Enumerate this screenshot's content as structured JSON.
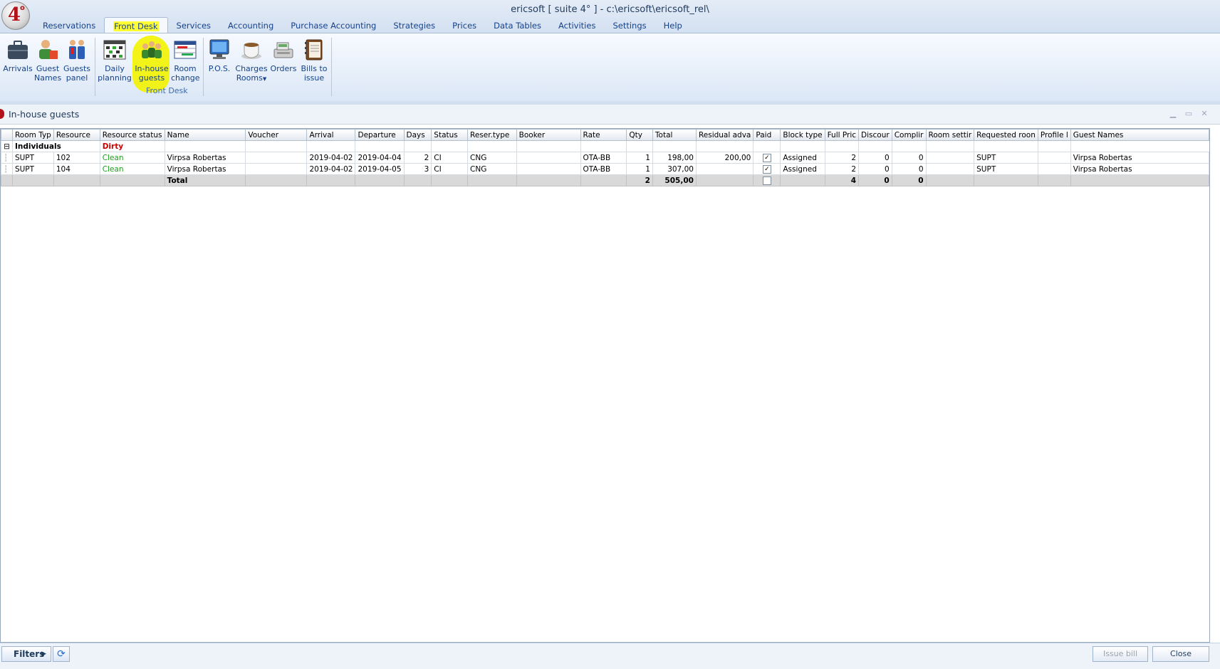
{
  "window": {
    "title": "ericsoft [ suite 4° ] - c:\\ericsoft\\ericsoft_rel\\"
  },
  "logo": {
    "text": "4",
    "sup": "o"
  },
  "tabs": [
    "Reservations",
    "Front Desk",
    "Services",
    "Accounting",
    "Purchase Accounting",
    "Strategies",
    "Prices",
    "Data Tables",
    "Activities",
    "Settings",
    "Help"
  ],
  "ribbon": {
    "group_label": "Front Desk",
    "buttons": {
      "arrivals": [
        "Arrivals"
      ],
      "guest_names": [
        "Guest",
        "Names"
      ],
      "guests_panel": [
        "Guests",
        "panel"
      ],
      "daily_planning": [
        "Daily",
        "planning"
      ],
      "inhouse_guests": [
        "In-house",
        "guests"
      ],
      "room_change": [
        "Room",
        "change"
      ],
      "pos": [
        "P.O.S."
      ],
      "charges_rooms": [
        "Charges",
        "Rooms"
      ],
      "orders": [
        "Orders"
      ],
      "bills_to_issue": [
        "Bills to",
        "issue"
      ]
    }
  },
  "panel": {
    "title": "In-house guests"
  },
  "grid": {
    "columns": [
      "Room Typ",
      "Resource",
      "Resource status",
      "Name",
      "Voucher",
      "Arrival",
      "Departure",
      "Days",
      "Status",
      "Reser.type",
      "Booker",
      "Rate",
      "Qty",
      "Total",
      "Residual adva",
      "Paid",
      "Block type",
      "Full Pric",
      "Discour",
      "Complir",
      "Room settir",
      "Requested roon",
      "Profile l",
      "Guest Names"
    ],
    "group": {
      "label": "Individuals",
      "status": "Dirty"
    },
    "rows": [
      [
        "SUPT",
        "102",
        "Clean",
        "Virpsa Robertas",
        "",
        "2019-04-02",
        "2019-04-04",
        "2",
        "CI",
        "CNG",
        "",
        "OTA-BB",
        "1",
        "198,00",
        "200,00",
        "✓",
        "Assigned",
        "2",
        "0",
        "0",
        "",
        "SUPT",
        "",
        "Virpsa Robertas"
      ],
      [
        "SUPT",
        "104",
        "Clean",
        "Virpsa Robertas",
        "",
        "2019-04-02",
        "2019-04-05",
        "3",
        "CI",
        "CNG",
        "",
        "OTA-BB",
        "1",
        "307,00",
        "",
        "✓",
        "Assigned",
        "2",
        "0",
        "0",
        "",
        "SUPT",
        "",
        "Virpsa Robertas"
      ]
    ],
    "total": {
      "label": "Total",
      "qty": "2",
      "total": "505,00",
      "full_price": "4",
      "discount": "0",
      "compliment": "0"
    }
  },
  "footer": {
    "filters": "Filters",
    "issue_bill": "Issue bill",
    "close": "Close"
  },
  "colors": {
    "accent": "#15428b",
    "highlight": "#ffff33",
    "clean": "#19a019",
    "dirty": "#cc0000"
  }
}
